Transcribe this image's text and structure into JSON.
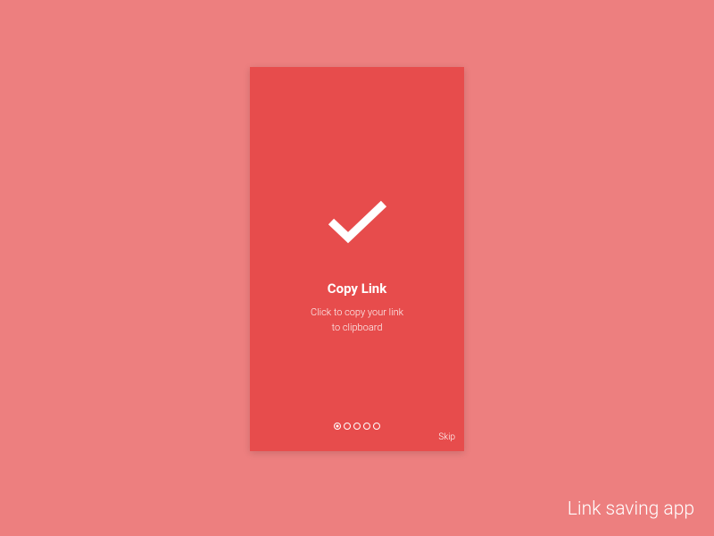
{
  "screen": {
    "title": "Copy Link",
    "description_line1": "Click to copy your link",
    "description_line2": "to clipboard",
    "skip_label": "Skip"
  },
  "pagination": {
    "total": 5,
    "active_index": 0
  },
  "footer": {
    "label": "Link saving app"
  },
  "colors": {
    "background": "#ed7f7f",
    "screen": "#e74c4c",
    "text": "#ffffff"
  }
}
